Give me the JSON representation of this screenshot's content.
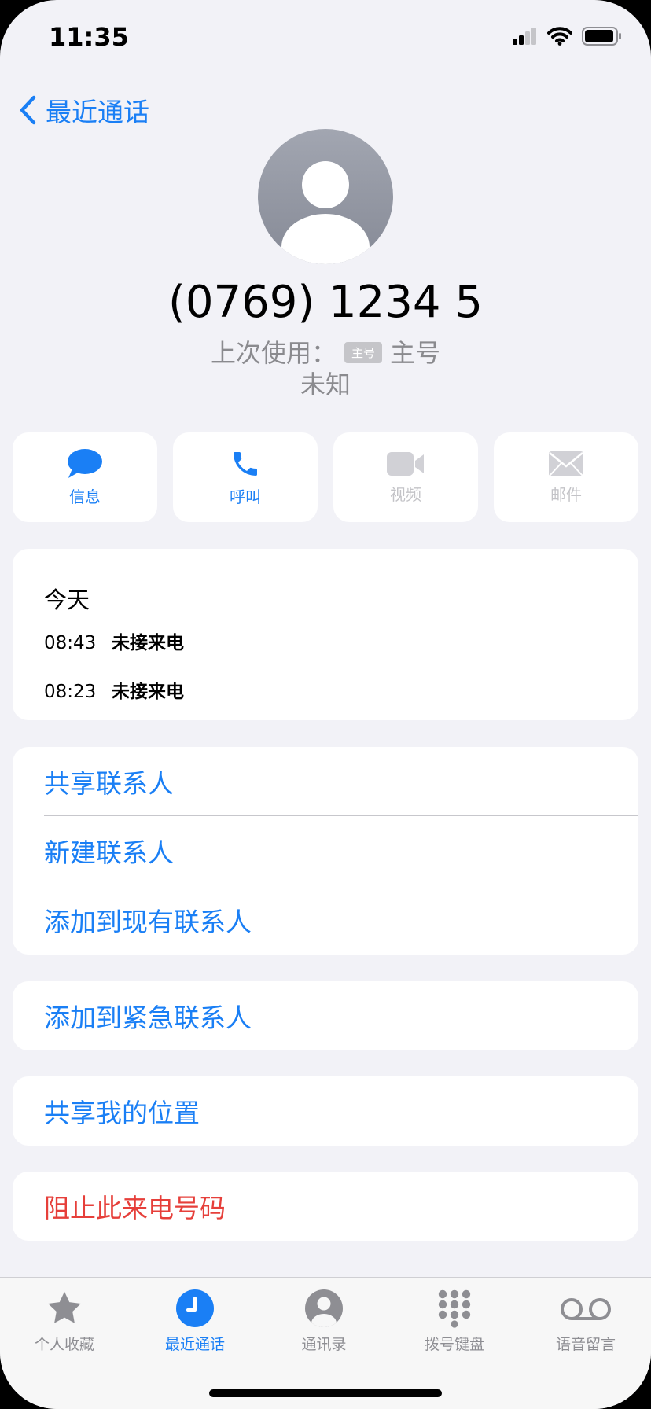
{
  "status_bar": {
    "time": "11:35"
  },
  "nav": {
    "back_label": "最近通话"
  },
  "contact": {
    "number": "(0769) 1234 5",
    "last_used_prefix": "上次使用：",
    "line_tag": "主号",
    "line_name": "主号",
    "status": "未知"
  },
  "actions": [
    {
      "label": "信息",
      "icon": "message-bubble-icon",
      "enabled": true
    },
    {
      "label": "呼叫",
      "icon": "phone-icon",
      "enabled": true
    },
    {
      "label": "视频",
      "icon": "video-camera-icon",
      "enabled": false
    },
    {
      "label": "邮件",
      "icon": "envelope-icon",
      "enabled": false
    }
  ],
  "history": {
    "day": "今天",
    "calls": [
      {
        "time": "08:43",
        "status": "未接来电"
      },
      {
        "time": "08:23",
        "status": "未接来电"
      }
    ]
  },
  "options": {
    "share_contact": "共享联系人",
    "new_contact": "新建联系人",
    "add_existing": "添加到现有联系人",
    "add_emergency": "添加到紧急联系人",
    "share_location": "共享我的位置",
    "block_caller": "阻止此来电号码"
  },
  "tabs": [
    {
      "label": "个人收藏",
      "icon": "star-icon",
      "active": false
    },
    {
      "label": "最近通话",
      "icon": "clock-icon",
      "active": true
    },
    {
      "label": "通讯录",
      "icon": "person-circle-icon",
      "active": false
    },
    {
      "label": "拨号键盘",
      "icon": "keypad-icon",
      "active": false
    },
    {
      "label": "语音留言",
      "icon": "voicemail-icon",
      "active": false
    }
  ],
  "colors": {
    "accent": "#1a7ff5",
    "destructive": "#e63f3a",
    "background": "#f2f2f7"
  }
}
